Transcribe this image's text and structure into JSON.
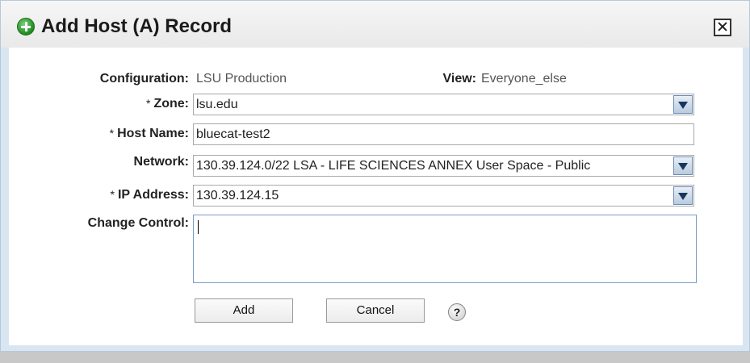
{
  "dialog": {
    "title": "Add Host (A) Record",
    "icon": "add-circle-icon",
    "close_icon": "close-icon"
  },
  "form": {
    "configuration": {
      "label": "Configuration:",
      "value": "LSU Production"
    },
    "view": {
      "label": "View:",
      "value": "Everyone_else"
    },
    "required_marker": "*",
    "zone": {
      "label": "Zone:",
      "value": "lsu.edu"
    },
    "host_name": {
      "label": "Host Name:",
      "value": "bluecat-test2"
    },
    "network": {
      "label": "Network:",
      "value": "130.39.124.0/22 LSA - LIFE SCIENCES ANNEX User Space - Public"
    },
    "ip_address": {
      "label": "IP Address:",
      "value": "130.39.124.15"
    },
    "change_control": {
      "label": "Change Control:",
      "value": ""
    }
  },
  "buttons": {
    "add": "Add",
    "cancel": "Cancel",
    "help": "?"
  },
  "colors": {
    "dialog_border": "#d9e6f2",
    "dropdown_arrow": "#17365d",
    "add_icon": "#1f8a1f"
  }
}
